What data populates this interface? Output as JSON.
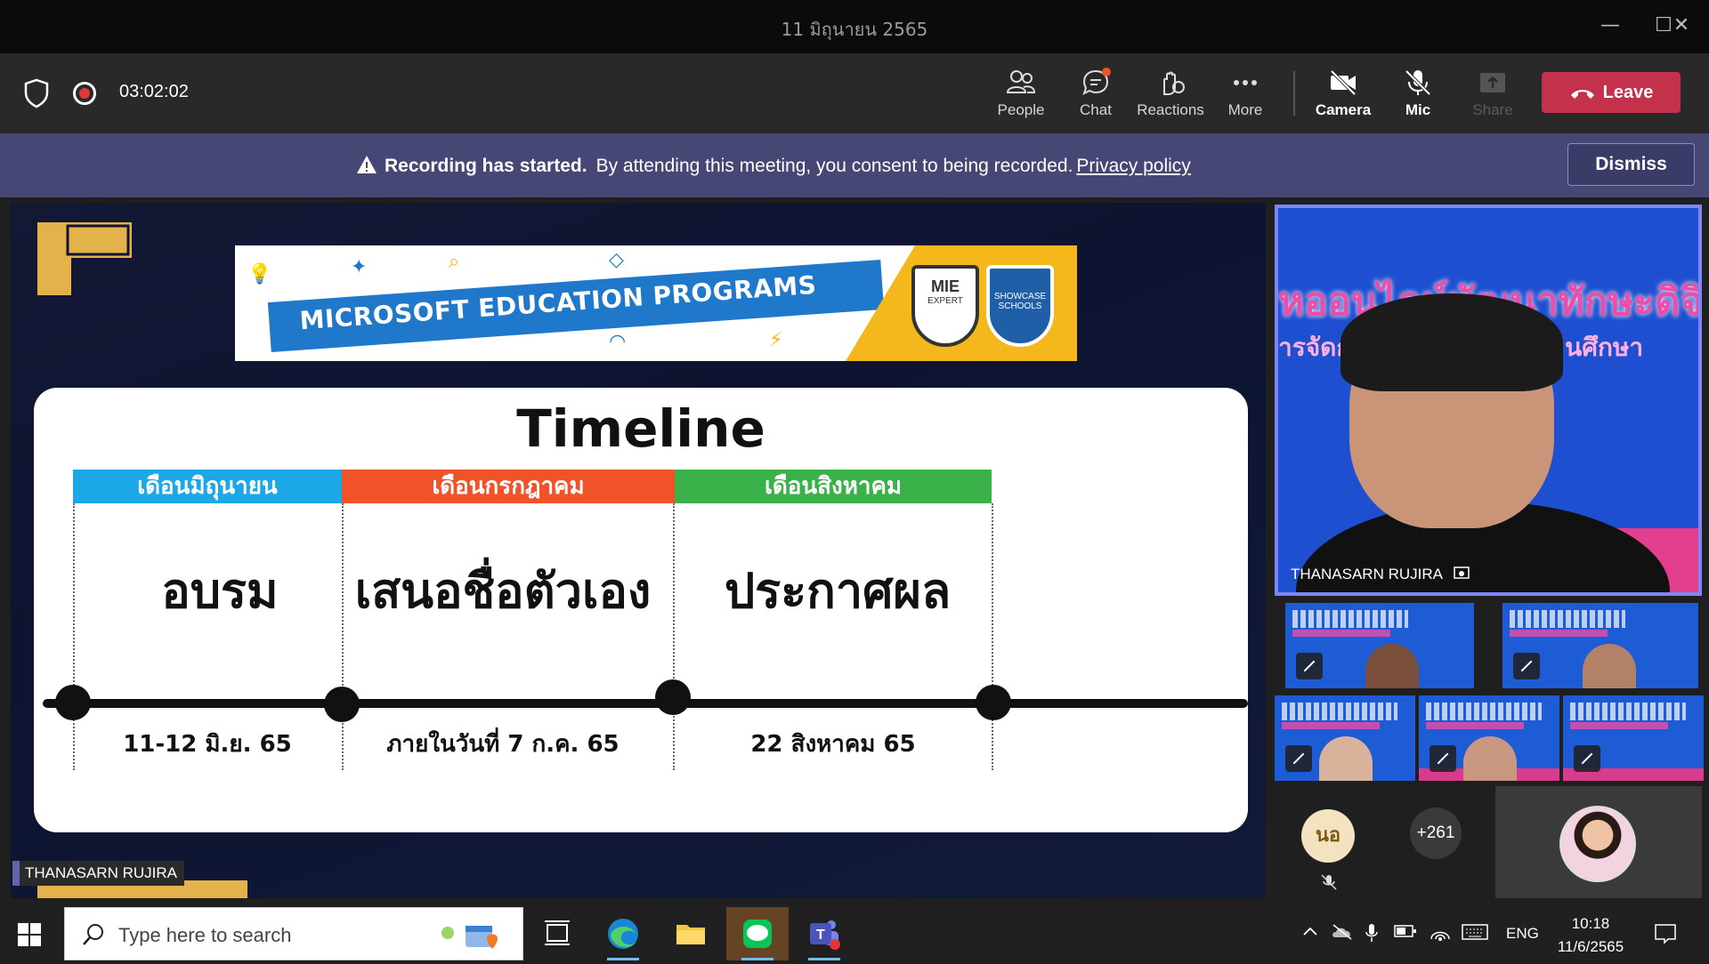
{
  "window": {
    "title": "11 มิถุนายน 2565",
    "min": "—",
    "max": "☐",
    "close": "✕"
  },
  "meeting": {
    "timer": "03:02:02",
    "buttons": [
      {
        "label": "People",
        "icon": "people-icon"
      },
      {
        "label": "Chat",
        "icon": "chat-icon"
      },
      {
        "label": "Reactions",
        "icon": "reactions-icon"
      },
      {
        "label": "More",
        "icon": "more-icon"
      },
      {
        "label": "Camera",
        "icon": "camera-off-icon"
      },
      {
        "label": "Mic",
        "icon": "mic-off-icon"
      },
      {
        "label": "Share",
        "icon": "share-icon"
      }
    ],
    "leave_label": "Leave"
  },
  "banner": {
    "bold": "Recording has started.",
    "text": "By attending this meeting, you consent to being recorded.",
    "link": "Privacy policy",
    "dismiss": "Dismiss"
  },
  "slide": {
    "program_banner": "MICROSOFT EDUCATION PROGRAMS",
    "badge_mie_line1": "MIE",
    "badge_mie_line2": "EXPERT",
    "badge_schools": "SHOWCASE SCHOOLS",
    "title": "Timeline",
    "columns": [
      {
        "month": "เดือนมิถุนายน",
        "color": "#1ca7e6",
        "phase": "อบรม",
        "date": "11-12 มิ.ย. 65"
      },
      {
        "month": "เดือนกรกฎาคม",
        "color": "#f0522a",
        "phase": "เสนอชื่อตัวเอง",
        "date": "ภายในวันที่ 7 ก.ค. 65"
      },
      {
        "month": "เดือนสิงหาคม",
        "color": "#3bb14a",
        "phase": "ประกาศผล",
        "date": "22 สิงหาคม 65"
      }
    ],
    "presenter": "THANASARN RUJIRA"
  },
  "participants": {
    "main_name": "THANASARN RUJIRA",
    "main_overlay_line1": "หออนไลน์พัฒนาทักษะดิจิทั",
    "main_overlay_line2": "ารจัดการเรียนรู้สำหรับสถานศึกษา",
    "avatar_initials": "นอ",
    "more_count": "+261"
  },
  "taskbar": {
    "search_placeholder": "Type here to search",
    "lang": "ENG",
    "time": "10:18",
    "date": "11/6/2565"
  }
}
